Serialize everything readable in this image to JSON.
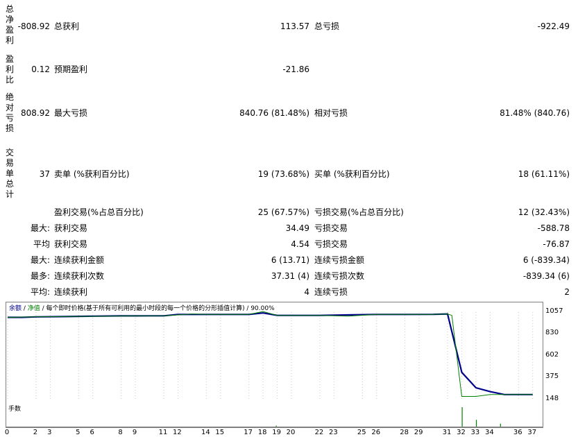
{
  "summary": {
    "net_profit_label": "总净盈利",
    "net_profit_value": "-808.92",
    "gross_profit_label": "总获利",
    "gross_profit_value": "113.57",
    "gross_loss_label": "总亏损",
    "gross_loss_value": "-922.49",
    "profit_factor_label": "盈利比",
    "profit_factor_value": "0.12",
    "expected_payoff_label": "预期盈利",
    "expected_payoff_value": "-21.86",
    "abs_drawdown_label": "绝对亏损",
    "abs_drawdown_value": "808.92",
    "max_drawdown_label": "最大亏损",
    "max_drawdown_value": "840.76 (81.48%)",
    "rel_drawdown_label": "相对亏损",
    "rel_drawdown_value": "81.48% (840.76)",
    "total_trades_label": "交易单总计",
    "total_trades_value": "37",
    "short_label": "卖单 (%获利百分比)",
    "short_value": "19 (73.68%)",
    "long_label": "买单 (%获利百分比)",
    "long_value": "18 (61.11%)"
  },
  "details": [
    {
      "prefix": "",
      "label1": "盈利交易(%占总百分比)",
      "value1": "25 (67.57%)",
      "label2": "亏损交易(%占总百分比)",
      "value2": "12 (32.43%)"
    },
    {
      "prefix": "最大:",
      "label1": "获利交易",
      "value1": "34.49",
      "label2": "亏损交易",
      "value2": "-588.78"
    },
    {
      "prefix": "平均",
      "label1": "获利交易",
      "value1": "4.54",
      "label2": "亏损交易",
      "value2": "-76.87"
    },
    {
      "prefix": "最大:",
      "label1": "连续获利金额",
      "value1": "6 (13.71)",
      "label2": "连续亏损金额",
      "value2": "6 (-839.34)"
    },
    {
      "prefix": "最多:",
      "label1": "连续获利次数",
      "value1": "37.31 (4)",
      "label2": "连续亏损次数",
      "value2": "-839.34 (6)"
    },
    {
      "prefix": "平均:",
      "label1": "连续获利",
      "value1": "4",
      "label2": "连续亏损",
      "value2": "2"
    }
  ],
  "chart": {
    "caption_balance": "余额",
    "caption_sep1": " / ",
    "caption_equity": "净值",
    "caption_rest": " / 每个即时价格(基于所有可利用的最小时段的每一个价格的分形插值计算) / 90.00%",
    "volume_caption": "手数",
    "colors": {
      "balance": "#00008b",
      "equity": "#008000",
      "volume": "#008000"
    }
  },
  "chart_data": {
    "type": "line",
    "ylim": [
      148,
      1140
    ],
    "yticks": [
      "1057",
      "830",
      "602",
      "375",
      "148"
    ],
    "ytick_values": [
      1057,
      830,
      602,
      375,
      148
    ],
    "x_ticks": [
      "0",
      "2",
      "3",
      "5",
      "6",
      "8",
      "9",
      "11",
      "12",
      "14",
      "15",
      "17",
      "18",
      "19",
      "20",
      "22",
      "23",
      "25",
      "26",
      "28",
      "29",
      "31",
      "32",
      "33",
      "34",
      "36",
      "37"
    ],
    "series": [
      {
        "key": "balance",
        "x": [
          0,
          1,
          2,
          4,
          6,
          8,
          9,
          10,
          11,
          12,
          14,
          16,
          17,
          18,
          19,
          20,
          22,
          24,
          26,
          28,
          30,
          31,
          32,
          33,
          34,
          35,
          36,
          37
        ],
        "y": [
          1000,
          1000,
          1005,
          1008,
          1012,
          1015,
          1015,
          1016,
          1016,
          1030,
          1030,
          1030,
          1030,
          1045,
          1020,
          1020,
          1020,
          1025,
          1030,
          1030,
          1031,
          1035,
          430,
          270,
          230,
          200,
          200,
          200
        ]
      },
      {
        "key": "equity",
        "x": [
          0,
          2,
          4,
          9,
          11,
          12,
          13,
          14,
          16,
          17,
          18,
          19,
          20,
          22,
          24,
          26,
          28,
          30,
          31,
          31.3,
          32,
          33,
          34,
          35,
          36,
          37
        ],
        "y": [
          1000,
          1005,
          1008,
          1015,
          1016,
          1025,
          1035,
          1030,
          1030,
          1030,
          1060,
          1020,
          1020,
          1020,
          1012,
          1030,
          1030,
          1031,
          1035,
          1020,
          180,
          180,
          200,
          200,
          200,
          200
        ]
      }
    ],
    "volume": {
      "x": [
        18.9,
        32,
        33,
        34.7
      ],
      "v": [
        0.05,
        1.0,
        0.35,
        0.15
      ]
    }
  }
}
